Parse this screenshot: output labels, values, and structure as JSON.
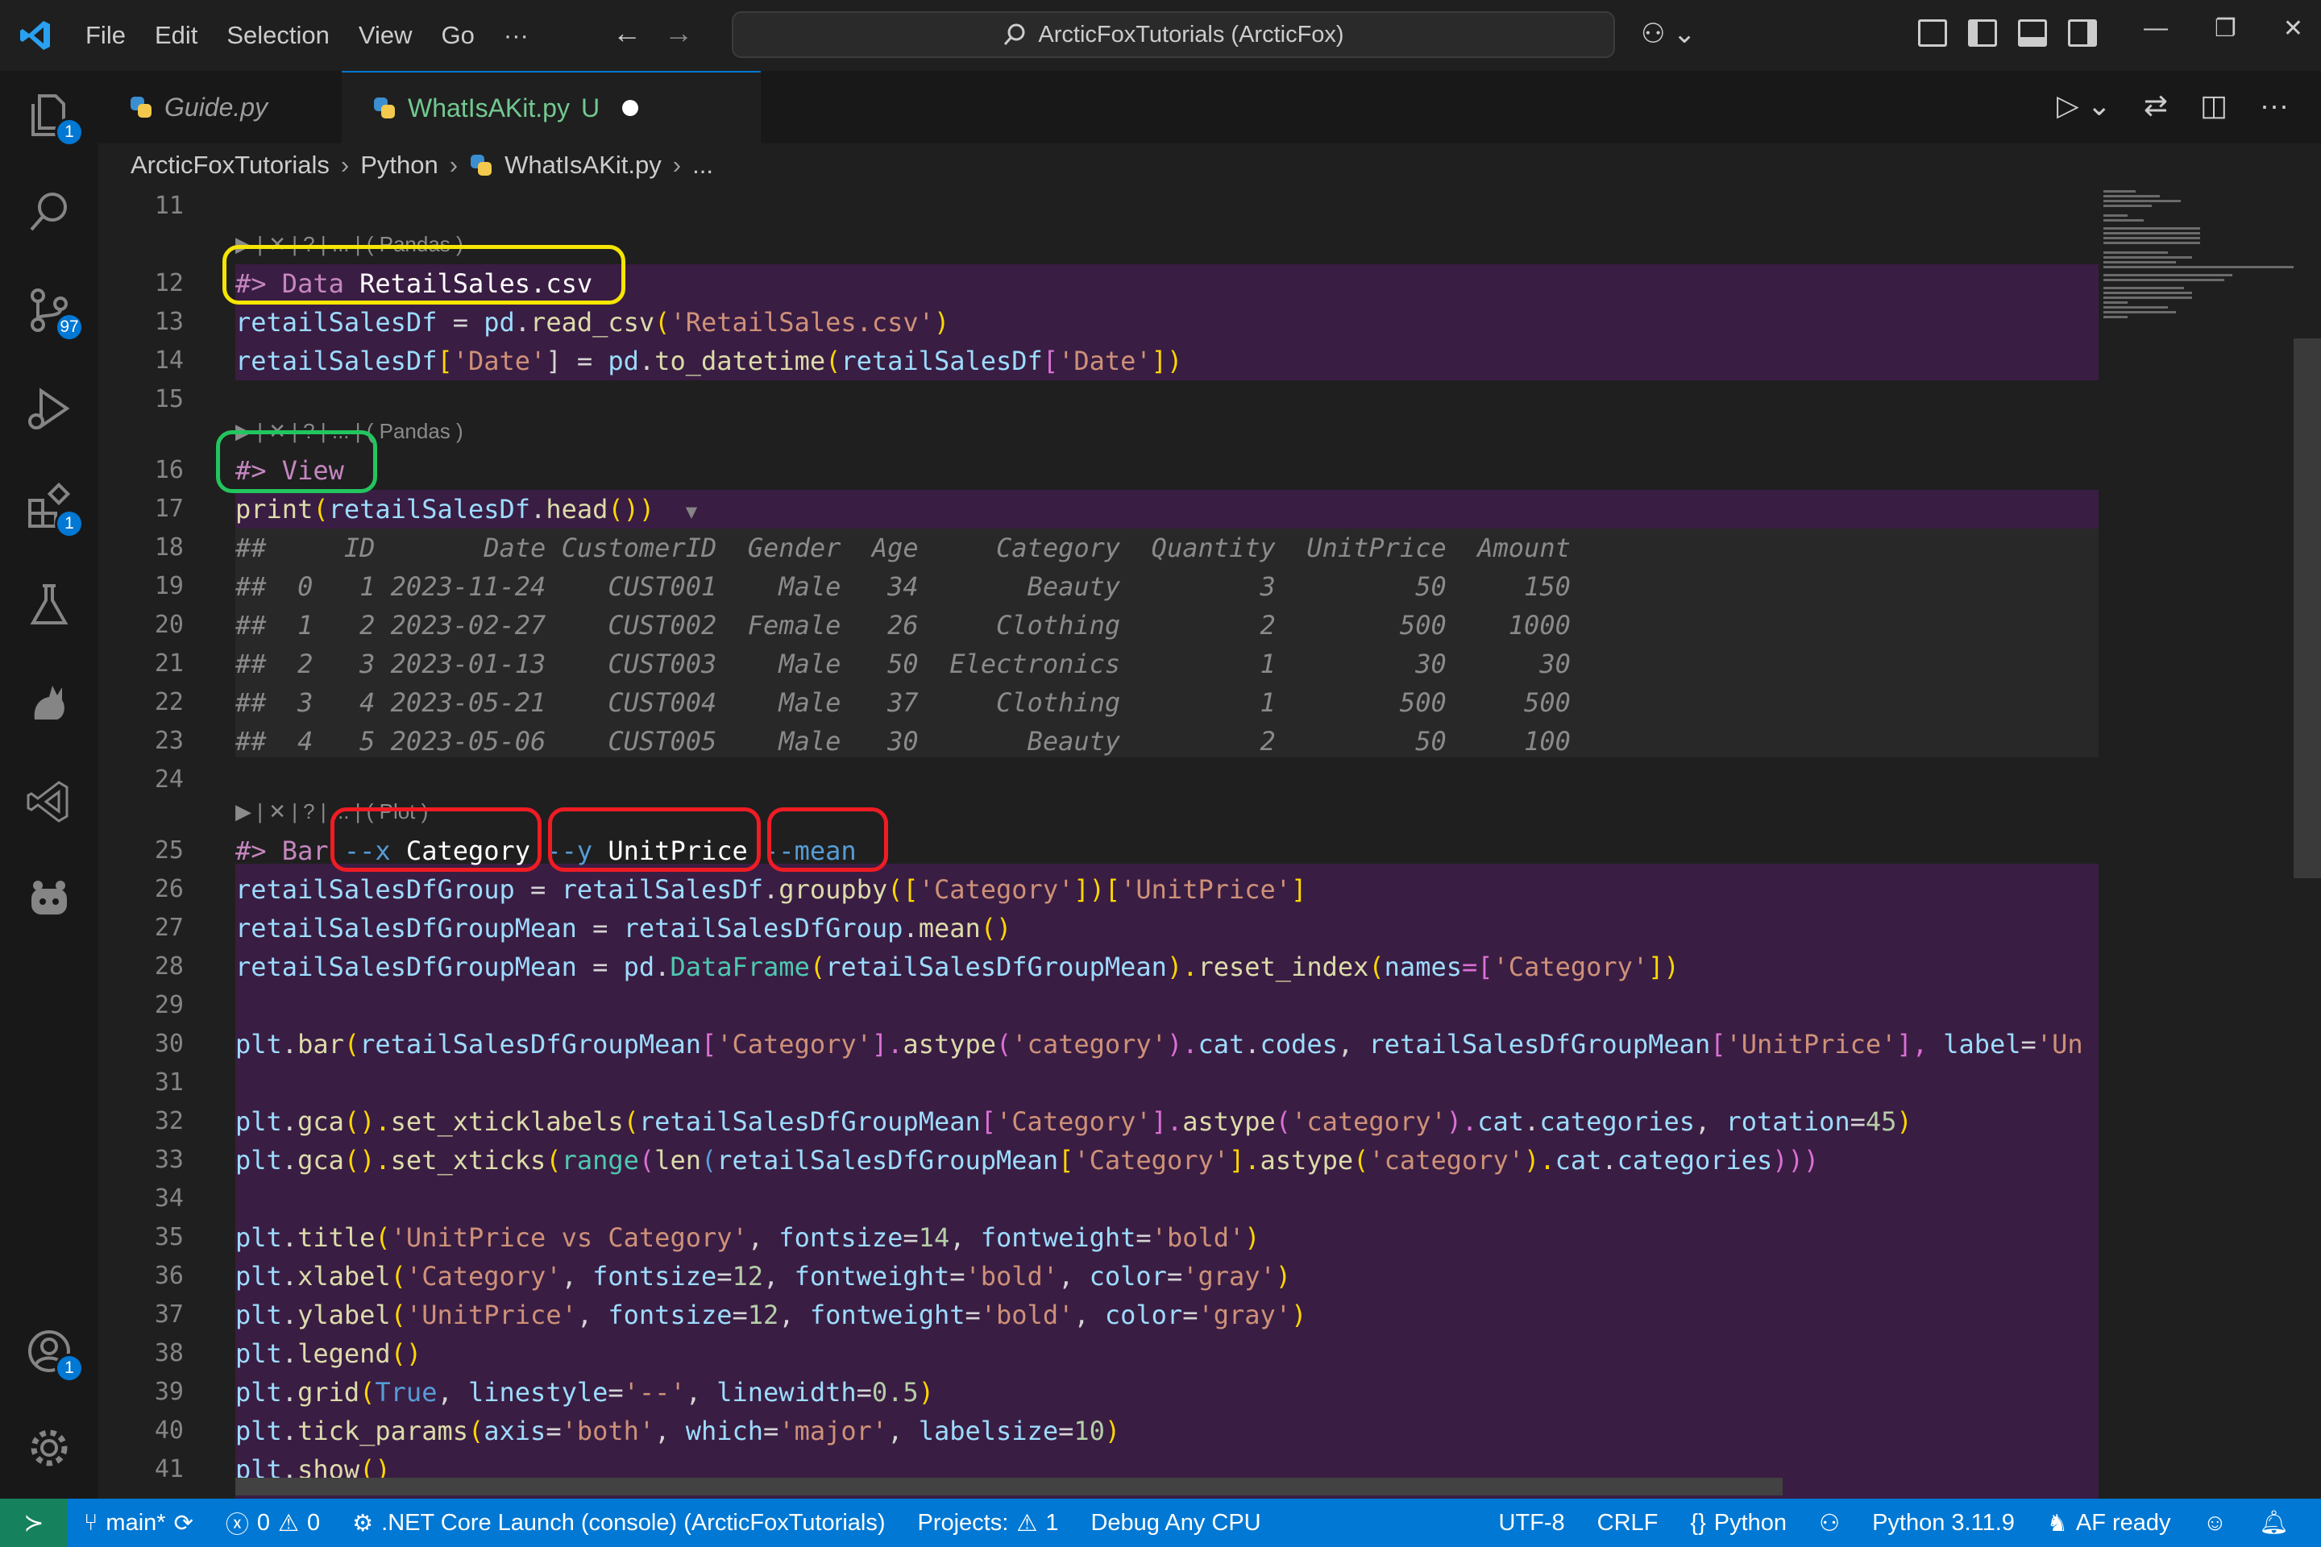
{
  "menu": {
    "file": "File",
    "edit": "Edit",
    "selection": "Selection",
    "view": "View",
    "go": "Go",
    "more": "···"
  },
  "search": {
    "text": "ArcticFoxTutorials (ArcticFox)"
  },
  "activity": {
    "explorer_badge": "1",
    "scm_badge": "97",
    "extensions_badge": "1",
    "accounts_badge": "1"
  },
  "tabs": [
    {
      "label": "Guide.py",
      "status": ""
    },
    {
      "label": "WhatIsAKit.py",
      "status": "U"
    }
  ],
  "breadcrumb": {
    "root": "ArcticFoxTutorials",
    "folder": "Python",
    "file": "WhatIsAKit.py",
    "more": "..."
  },
  "codelens": {
    "cell1": "▶ | ✕ | ? | ... | ( Pandas )",
    "cell2": "▶ | ✕ | ? | ... | ( Pandas )",
    "cell3": "▶ | ✕ | ? | ... | ( Plot )"
  },
  "lines": {
    "l11": "11",
    "l12": "12",
    "l13": "13",
    "l14": "14",
    "l15": "15",
    "l16": "16",
    "l17": "17",
    "l18": "18",
    "l19": "19",
    "l20": "20",
    "l21": "21",
    "l22": "22",
    "l23": "23",
    "l24": "24",
    "l25": "25",
    "l26": "26",
    "l27": "27",
    "l28": "28",
    "l29": "29",
    "l30": "30",
    "l31": "31",
    "l32": "32",
    "l33": "33",
    "l34": "34",
    "l35": "35",
    "l36": "36",
    "l37": "37",
    "l38": "38",
    "l39": "39",
    "l40": "40",
    "l41": "41"
  },
  "code": {
    "c12a": "#> Data ",
    "c12b": "RetailSales.csv",
    "c13a": "retailSalesDf",
    "c13b": " = ",
    "c13c": "pd",
    "c13d": ".",
    "c13e": "read_csv",
    "c13f": "(",
    "c13g": "'RetailSales.csv'",
    "c13h": ")",
    "c14a": "retailSalesDf",
    "c14b": "[",
    "c14c": "'Date'",
    "c14d": "] = ",
    "c14e": "pd",
    "c14f": ".",
    "c14g": "to_datetime",
    "c14h": "(",
    "c14i": "retailSalesDf",
    "c14j": "[",
    "c14k": "'Date'",
    "c14l": "])",
    "c16": "#> View",
    "c17a": "print",
    "c17b": "(",
    "c17c": "retailSalesDf",
    "c17d": ".",
    "c17e": "head",
    "c17f": "())",
    "c17g": "▼",
    "o18": "##     ID       Date CustomerID  Gender  Age     Category  Quantity  UnitPrice  Amount",
    "o19": "##  0   1 2023-11-24    CUST001    Male   34       Beauty         3         50     150",
    "o20": "##  1   2 2023-02-27    CUST002  Female   26     Clothing         2        500    1000",
    "o21": "##  2   3 2023-01-13    CUST003    Male   50  Electronics         1         30      30",
    "o22": "##  3   4 2023-05-21    CUST004    Male   37     Clothing         1        500     500",
    "o23": "##  4   5 2023-05-06    CUST005    Male   30       Beauty         2         50     100",
    "c25a": "#> Bar ",
    "c25b": "--x ",
    "c25c": "Category ",
    "c25d": "--y ",
    "c25e": "UnitPrice ",
    "c25f": "--mean",
    "c26a": "retailSalesDfGroup",
    "c26b": " = ",
    "c26c": "retailSalesDf",
    "c26d": ".",
    "c26e": "groupby",
    "c26f": "([",
    "c26g": "'Category'",
    "c26h": "])[",
    "c26i": "'UnitPrice'",
    "c26j": "]",
    "c27a": "retailSalesDfGroupMean",
    "c27b": " = ",
    "c27c": "retailSalesDfGroup",
    "c27d": ".",
    "c27e": "mean",
    "c27f": "()",
    "c28a": "retailSalesDfGroupMean",
    "c28b": " = ",
    "c28c": "pd",
    "c28d": ".",
    "c28e": "DataFrame",
    "c28f": "(",
    "c28g": "retailSalesDfGroupMean",
    "c28h": ").",
    "c28i": "reset_index",
    "c28j": "(",
    "c28k": "names",
    "c28l": "=[",
    "c28m": "'Category'",
    "c28n": "])",
    "c30a": "plt",
    "c30b": ".",
    "c30c": "bar",
    "c30d": "(",
    "c30e": "retailSalesDfGroupMean",
    "c30f": "[",
    "c30g": "'Category'",
    "c30h": "].",
    "c30i": "astype",
    "c30j": "(",
    "c30k": "'category'",
    "c30l": ").",
    "c30m": "cat",
    "c30n": ".",
    "c30o": "codes",
    "c30p": ", ",
    "c30q": "retailSalesDfGroupMean",
    "c30r": "[",
    "c30s": "'UnitPrice'",
    "c30t": "], ",
    "c30u": "label",
    "c30v": "=",
    "c30w": "'Un",
    "c32a": "plt",
    "c32b": ".",
    "c32c": "gca",
    "c32d": "().",
    "c32e": "set_xticklabels",
    "c32f": "(",
    "c32g": "retailSalesDfGroupMean",
    "c32h": "[",
    "c32i": "'Category'",
    "c32j": "].",
    "c32k": "astype",
    "c32l": "(",
    "c32m": "'category'",
    "c32n": ").",
    "c32o": "cat",
    "c32p": ".",
    "c32q": "categories",
    "c32r": ", ",
    "c32s": "rotation",
    "c32t": "=",
    "c32u": "45",
    "c32v": ")",
    "c33a": "plt",
    "c33b": ".",
    "c33c": "gca",
    "c33d": "().",
    "c33e": "set_xticks",
    "c33f": "(",
    "c33g": "range",
    "c33h": "(",
    "c33i": "len",
    "c33j": "(",
    "c33k": "retailSalesDfGroupMean",
    "c33l": "[",
    "c33m": "'Category'",
    "c33n": "].",
    "c33o": "astype",
    "c33p": "(",
    "c33q": "'category'",
    "c33r": ").",
    "c33s": "cat",
    "c33t": ".",
    "c33u": "categories",
    "c33v": ")))",
    "c35a": "plt",
    "c35b": ".",
    "c35c": "title",
    "c35d": "(",
    "c35e": "'UnitPrice vs Category'",
    "c35f": ", ",
    "c35g": "fontsize",
    "c35h": "=",
    "c35i": "14",
    "c35j": ", ",
    "c35k": "fontweight",
    "c35l": "=",
    "c35m": "'bold'",
    "c35n": ")",
    "c36a": "plt",
    "c36b": ".",
    "c36c": "xlabel",
    "c36d": "(",
    "c36e": "'Category'",
    "c36f": ", ",
    "c36g": "fontsize",
    "c36h": "=",
    "c36i": "12",
    "c36j": ", ",
    "c36k": "fontweight",
    "c36l": "=",
    "c36m": "'bold'",
    "c36n": ", ",
    "c36o": "color",
    "c36p": "=",
    "c36q": "'gray'",
    "c36r": ")",
    "c37a": "plt",
    "c37b": ".",
    "c37c": "ylabel",
    "c37d": "(",
    "c37e": "'UnitPrice'",
    "c37f": ", ",
    "c37g": "fontsize",
    "c37h": "=",
    "c37i": "12",
    "c37j": ", ",
    "c37k": "fontweight",
    "c37l": "=",
    "c37m": "'bold'",
    "c37n": ", ",
    "c37o": "color",
    "c37p": "=",
    "c37q": "'gray'",
    "c37r": ")",
    "c38a": "plt",
    "c38b": ".",
    "c38c": "legend",
    "c38d": "()",
    "c39a": "plt",
    "c39b": ".",
    "c39c": "grid",
    "c39d": "(",
    "c39e": "True",
    "c39f": ", ",
    "c39g": "linestyle",
    "c39h": "=",
    "c39i": "'--'",
    "c39j": ", ",
    "c39k": "linewidth",
    "c39l": "=",
    "c39m": "0.5",
    "c39n": ")",
    "c40a": "plt",
    "c40b": ".",
    "c40c": "tick_params",
    "c40d": "(",
    "c40e": "axis",
    "c40f": "=",
    "c40g": "'both'",
    "c40h": ", ",
    "c40i": "which",
    "c40j": "=",
    "c40k": "'major'",
    "c40l": ", ",
    "c40m": "labelsize",
    "c40n": "=",
    "c40o": "10",
    "c40p": ")",
    "c41a": "plt",
    "c41b": ".",
    "c41c": "show",
    "c41d": "()"
  },
  "status": {
    "branch": "main*",
    "errors": "0",
    "warnings": "0",
    "launch": ".NET Core Launch (console) (ArcticFoxTutorials)",
    "projects": "Projects:",
    "projects_count": "1",
    "debug": "Debug Any CPU",
    "encoding": "UTF-8",
    "eol": "CRLF",
    "language": "Python",
    "interpreter": "Python 3.11.9",
    "af": "AF ready"
  },
  "colors": {
    "accent": "#0078d4",
    "remote": "#16825d",
    "cell_bg": "#3a1d43",
    "yellow_box": "#f5e500",
    "green_box": "#22c55e",
    "red_box": "#ef1c24"
  }
}
